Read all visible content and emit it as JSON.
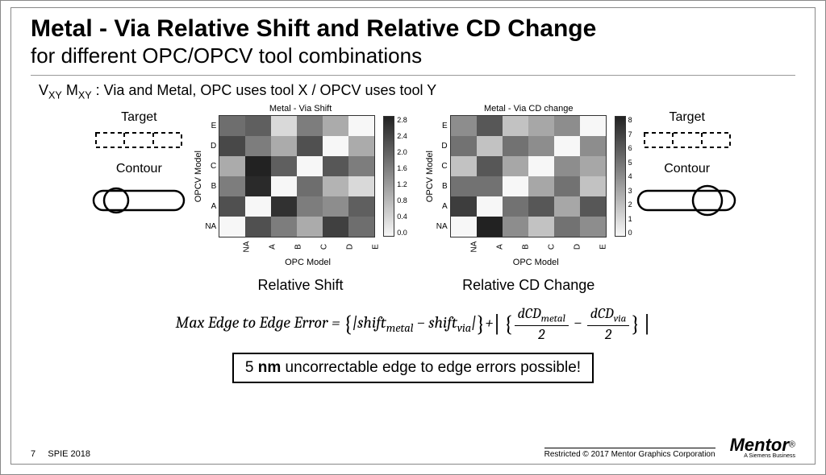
{
  "header": {
    "title_bold": "Metal - Via Relative Shift and Relative CD Change",
    "subtitle": "for different OPC/OPCV tool combinations"
  },
  "notation": "V<sub>XY</sub> M<sub>XY</sub> : Via and Metal, OPC uses tool X / OPCV uses tool Y",
  "side_labels": {
    "target": "Target",
    "contour": "Contour"
  },
  "axes": {
    "ylabel": "OPCV Model",
    "xlabel": "OPC Model",
    "categories": [
      "NA",
      "A",
      "B",
      "C",
      "D",
      "E"
    ],
    "rows_display": [
      "E",
      "D",
      "C",
      "B",
      "A",
      "NA"
    ]
  },
  "captions": {
    "shift": "Relative Shift",
    "cd": "Relative CD Change"
  },
  "chart_data": [
    {
      "type": "heatmap",
      "title": "Metal - Via Shift",
      "xlabel": "OPC Model",
      "ylabel": "OPCV Model",
      "x": [
        "NA",
        "A",
        "B",
        "C",
        "D",
        "E"
      ],
      "y": [
        "NA",
        "A",
        "B",
        "C",
        "D",
        "E"
      ],
      "z": [
        [
          0.0,
          2.2,
          1.6,
          1.0,
          2.4,
          1.8
        ],
        [
          2.2,
          0.0,
          2.6,
          1.6,
          1.4,
          2.0
        ],
        [
          1.6,
          2.7,
          0.0,
          1.8,
          0.9,
          0.4
        ],
        [
          1.0,
          2.8,
          2.0,
          0.0,
          2.1,
          1.6
        ],
        [
          2.3,
          1.6,
          1.0,
          2.2,
          0.0,
          1.0
        ],
        [
          1.8,
          2.0,
          0.4,
          1.6,
          1.0,
          0.0
        ]
      ],
      "colorbar_ticks": [
        "2.8",
        "2.4",
        "2.0",
        "1.6",
        "1.2",
        "0.8",
        "0.4",
        "0.0"
      ],
      "zmin": 0.0,
      "zmax": 2.8
    },
    {
      "type": "heatmap",
      "title": "Metal - Via CD change",
      "xlabel": "OPC Model",
      "ylabel": "OPCV Model",
      "x": [
        "NA",
        "A",
        "B",
        "C",
        "D",
        "E"
      ],
      "y": [
        "NA",
        "A",
        "B",
        "C",
        "D",
        "E"
      ],
      "z": [
        [
          0,
          8,
          4,
          2,
          5,
          4
        ],
        [
          7,
          0,
          5,
          6,
          3,
          6
        ],
        [
          5,
          5,
          0,
          3,
          5,
          2
        ],
        [
          2,
          6,
          3,
          0,
          4,
          3
        ],
        [
          5,
          2,
          5,
          4,
          0,
          4
        ],
        [
          4,
          6,
          2,
          3,
          4,
          0
        ]
      ],
      "colorbar_ticks": [
        "8",
        "7",
        "6",
        "5",
        "4",
        "3",
        "2",
        "1",
        "0"
      ],
      "zmin": 0,
      "zmax": 8
    }
  ],
  "formula_text": "Max Edge to Edge Error = {|shift_metal − shift_via|} + | { dCD_metal/2 − dCD_via/2 } |",
  "highlight": "5 nm uncorrectable edge to edge errors possible!",
  "footer": {
    "page_number": "7",
    "conference": "SPIE 2018",
    "restricted": "Restricted © 2017 Mentor Graphics Corporation",
    "logo_main": "Mentor",
    "logo_reg": "®",
    "logo_sub": "A Siemens Business"
  }
}
